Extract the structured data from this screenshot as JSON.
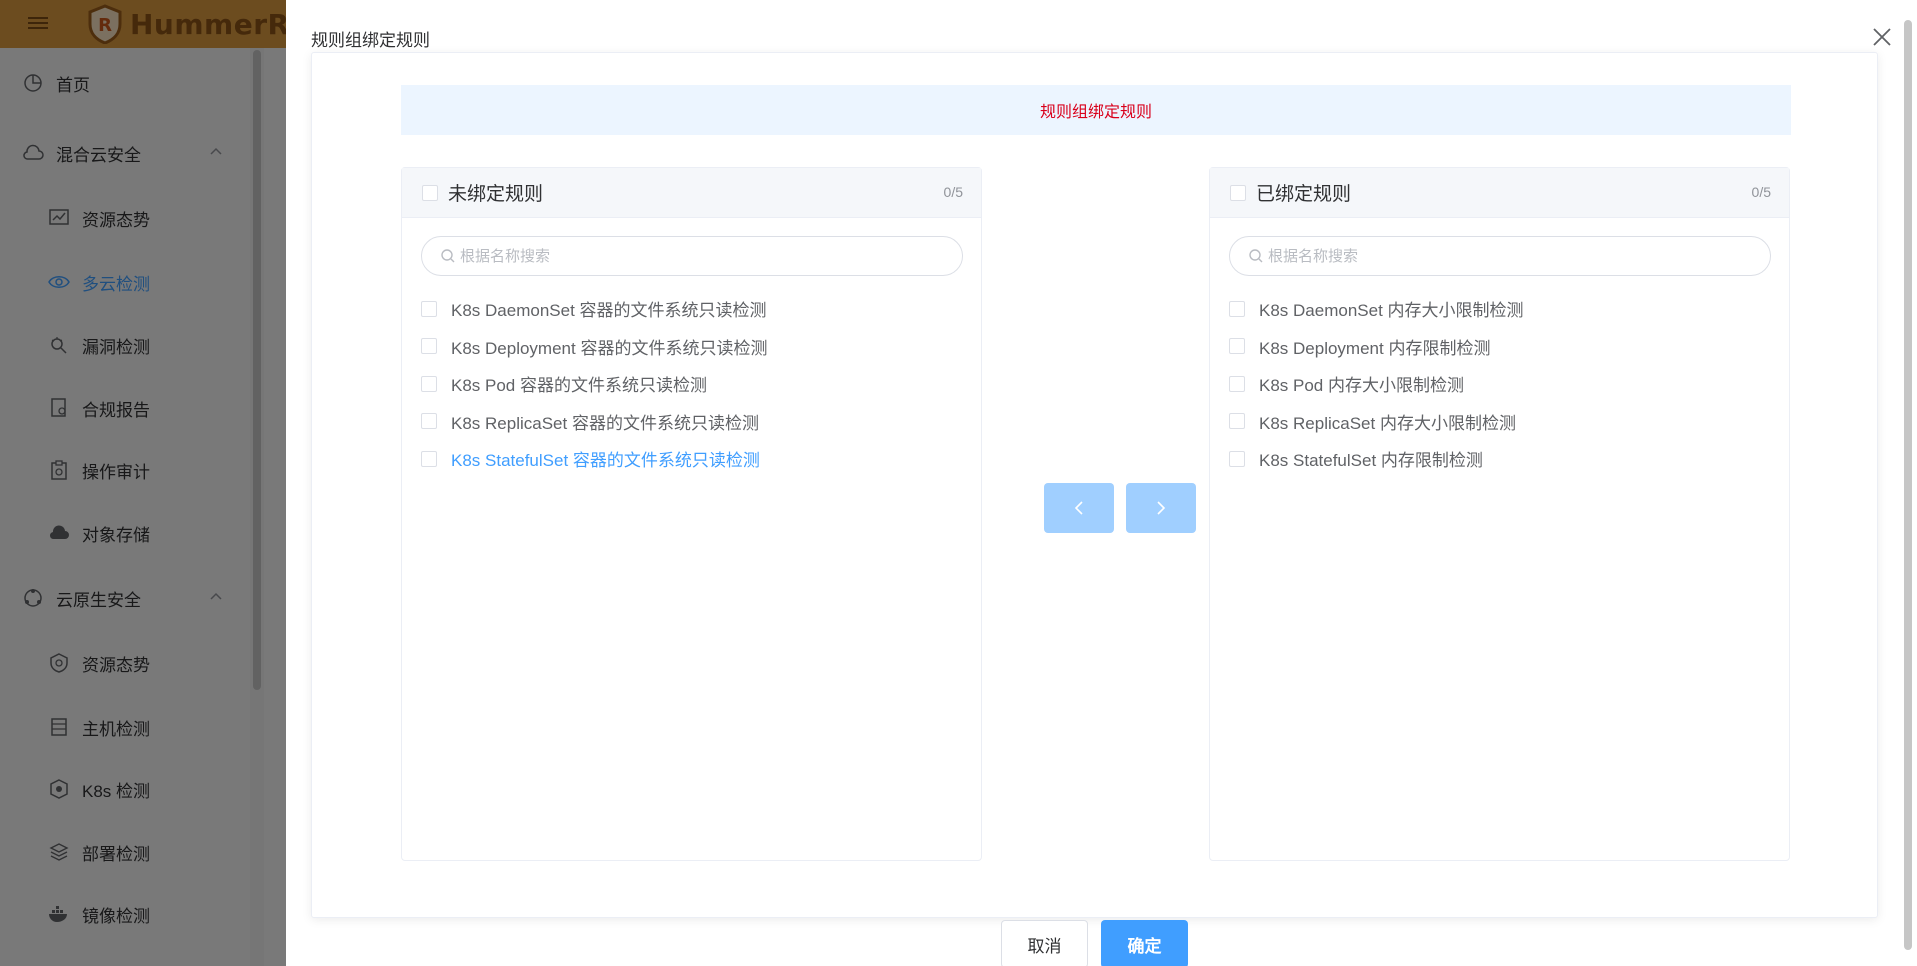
{
  "app": {
    "brand": "HummerRisk"
  },
  "sidebar": {
    "items": [
      {
        "label": "首页",
        "icon": "pie-chart-icon"
      },
      {
        "label": "混合云安全",
        "icon": "cloud-icon"
      },
      {
        "label": "资源态势",
        "icon": "line-chart-icon"
      },
      {
        "label": "多云检测",
        "icon": "eye-scan-icon"
      },
      {
        "label": "漏洞检测",
        "icon": "bug-search-icon"
      },
      {
        "label": "合规报告",
        "icon": "report-icon"
      },
      {
        "label": "操作审计",
        "icon": "clipboard-icon"
      },
      {
        "label": "对象存储",
        "icon": "cloud-storage-icon"
      },
      {
        "label": "云原生安全",
        "icon": "cluster-icon"
      },
      {
        "label": "资源态势",
        "icon": "shield-icon"
      },
      {
        "label": "主机检测",
        "icon": "server-icon"
      },
      {
        "label": "K8s 检测",
        "icon": "k8s-icon"
      },
      {
        "label": "部署检测",
        "icon": "layers-icon"
      },
      {
        "label": "镜像检测",
        "icon": "docker-icon"
      }
    ]
  },
  "drawer": {
    "title": "规则组绑定规则",
    "alert": "规则组绑定规则",
    "left_panel": {
      "title": "未绑定规则",
      "count": "0/5",
      "search_placeholder": "根据名称搜索",
      "items": [
        "K8s DaemonSet 容器的文件系统只读检测",
        "K8s Deployment 容器的文件系统只读检测",
        "K8s Pod 容器的文件系统只读检测",
        "K8s ReplicaSet 容器的文件系统只读检测",
        "K8s StatefulSet 容器的文件系统只读检测"
      ]
    },
    "right_panel": {
      "title": "已绑定规则",
      "count": "0/5",
      "search_placeholder": "根据名称搜索",
      "items": [
        "K8s DaemonSet 内存大小限制检测",
        "K8s Deployment 内存限制检测",
        "K8s Pod 内存大小限制检测",
        "K8s ReplicaSet 内存大小限制检测",
        "K8s StatefulSet 内存限制检测"
      ]
    },
    "cancel_label": "取消",
    "confirm_label": "确定"
  },
  "colors": {
    "brand": "#d8983e",
    "primary": "#409eff",
    "primary_disabled": "#a0cfff",
    "alert_text": "#d9001b",
    "alert_bg": "#ecf5ff"
  }
}
